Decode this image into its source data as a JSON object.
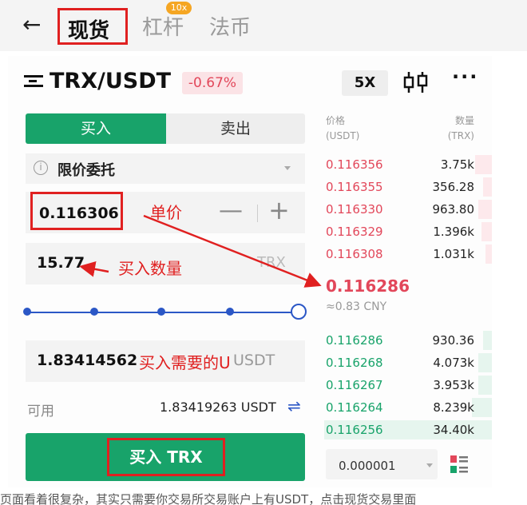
{
  "nav": {
    "back_icon": "arrow-left-icon",
    "tabs": [
      "现货",
      "杠杆",
      "法币"
    ],
    "margin_badge": "10x"
  },
  "header": {
    "pair": "TRX/USDT",
    "change": "-0.67%",
    "leverage": "5X",
    "more": "···"
  },
  "trade": {
    "buy_tab": "买入",
    "sell_tab": "卖出",
    "order_type": "限价委托",
    "price": "0.116306",
    "quantity": "15.77",
    "quantity_unit": "TRX",
    "total": "1.83414562",
    "total_unit": "USDT",
    "available_label": "可用",
    "available_value": "1.83419263 USDT",
    "buy_button": "买入 TRX"
  },
  "annotations": {
    "price_note": "单价",
    "qty_note": "买入数量",
    "total_note": "买入需要的U"
  },
  "orderbook": {
    "price_header": "价格",
    "price_unit": "(USDT)",
    "qty_header": "数量",
    "qty_unit": "(TRX)",
    "asks": [
      {
        "price": "0.116356",
        "qty": "3.75k",
        "depth": 0.1
      },
      {
        "price": "0.116355",
        "qty": "356.28",
        "depth": 0.05
      },
      {
        "price": "0.116330",
        "qty": "963.80",
        "depth": 0.08
      },
      {
        "price": "0.116329",
        "qty": "1.396k",
        "depth": 0.06
      },
      {
        "price": "0.116308",
        "qty": "1.031k",
        "depth": 0.04
      }
    ],
    "last_price": "0.116286",
    "last_cny": "≈0.83 CNY",
    "bids": [
      {
        "price": "0.116286",
        "qty": "930.36",
        "depth": 0.05
      },
      {
        "price": "0.116268",
        "qty": "4.073k",
        "depth": 0.08
      },
      {
        "price": "0.116267",
        "qty": "3.953k",
        "depth": 0.08
      },
      {
        "price": "0.116264",
        "qty": "8.239k",
        "depth": 0.12
      },
      {
        "price": "0.116256",
        "qty": "34.40k",
        "depth": 1.0
      }
    ],
    "tick_size": "0.000001"
  },
  "caption": "页面看着很复杂，其实只需要你交易所交易账户上有USDT，点击现货交易里面"
}
